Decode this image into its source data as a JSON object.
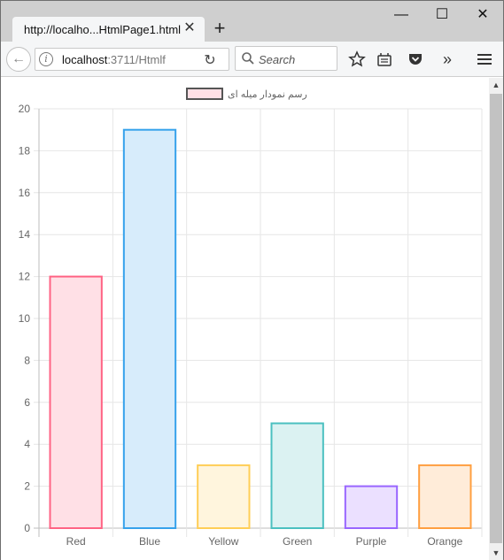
{
  "browser": {
    "tab_title": "http://localho...HtmlPage1.html",
    "new_tab_icon": "plus-icon",
    "url_host": "localhost",
    "url_path": ":3711/Htmlf",
    "search_placeholder": "Search"
  },
  "chart_data": {
    "type": "bar",
    "categories": [
      "Red",
      "Blue",
      "Yellow",
      "Green",
      "Purple",
      "Orange"
    ],
    "series": [
      {
        "name": "رسم نمودار میله ای",
        "values": [
          12,
          19,
          3,
          5,
          2,
          3
        ]
      }
    ],
    "ylim": [
      0,
      20
    ],
    "yticks": [
      0,
      2,
      4,
      6,
      8,
      10,
      12,
      14,
      16,
      18,
      20
    ],
    "grid": true,
    "legend_position": "top",
    "border_colors": [
      "#ff6384",
      "#36a2eb",
      "#ffce56",
      "#4bc0c0",
      "#9966ff",
      "#ff9f40"
    ],
    "fill_colors": [
      "#ffe0e6",
      "#d7ecfb",
      "#fff5dd",
      "#dbf2f2",
      "#ebe0ff",
      "#ffecd9"
    ]
  }
}
